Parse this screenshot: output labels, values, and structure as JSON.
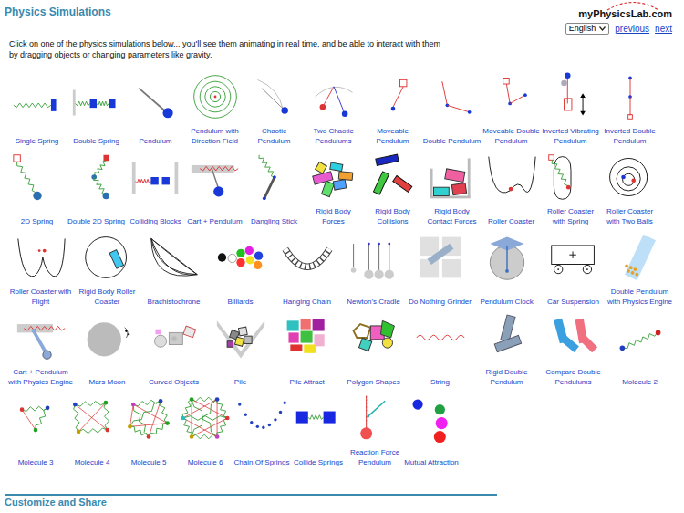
{
  "header": {
    "title": "Physics Simulations",
    "logo": "myPhysicsLab.com",
    "language": "English",
    "links": [
      "previous",
      "next"
    ]
  },
  "intro": "Click on one of the physics simulations below... you'll see them animating in real time, and be able to interact with them by dragging objects or changing parameters like gravity.",
  "gallery": {
    "rows": [
      [
        "Single Spring",
        "Double Spring",
        "Pendulum",
        "Pendulum with Direction Field",
        "Chaotic Pendulum",
        "Two Chaotic Pendulums",
        "Moveable Pendulum",
        "Double Pendulum",
        "Moveable Double Pendulum",
        "Inverted Vibrating Pendulum",
        "Inverted Double Pendulum"
      ],
      [
        "2D Spring",
        "Double 2D Spring",
        "Colliding Blocks",
        "Cart + Pendulum",
        "Dangling Stick",
        "Rigid Body Forces",
        "Rigid Body Collisions",
        "Rigid Body Contact Forces",
        "Roller Coaster",
        "Roller Coaster with Spring",
        "Roller Coaster with Two Balls"
      ],
      [
        "Roller Coaster with Flight",
        "Rigid Body Roller Coaster",
        "Brachistochrone",
        "Billiards",
        "Hanging Chain",
        "Newton's Cradle",
        "Do Nothing Grinder",
        "Pendulum Clock",
        "Car Suspension",
        "Double Pendulum with Physics Engine"
      ],
      [
        "Cart + Pendulum with Physics Engine",
        "Mars Moon",
        "Curved Objects",
        "Pile",
        "Pile Attract",
        "Polygon Shapes",
        "String",
        "Rigid Double Pendulum",
        "Compare Double Pendulums",
        "Molecule 2"
      ],
      [
        "Molecule 3",
        "Molecule 4",
        "Molecule 5",
        "Molecule 6",
        "Chain Of Springs",
        "Collide Springs",
        "Reaction Force Pendulum",
        "Mutual Attraction"
      ]
    ]
  },
  "footer": {
    "heading": "Customize and Share"
  }
}
